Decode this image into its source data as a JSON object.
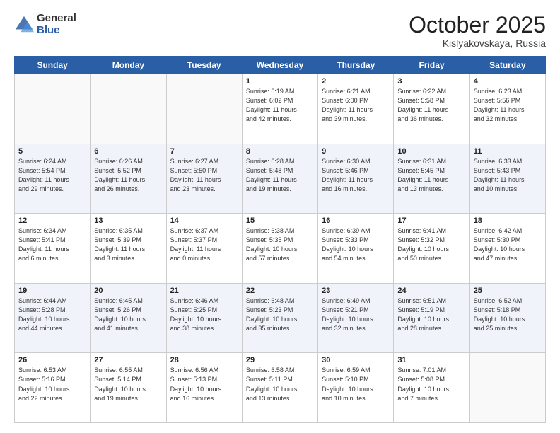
{
  "logo": {
    "general": "General",
    "blue": "Blue"
  },
  "header": {
    "month": "October 2025",
    "location": "Kislyakovskaya, Russia"
  },
  "weekdays": [
    "Sunday",
    "Monday",
    "Tuesday",
    "Wednesday",
    "Thursday",
    "Friday",
    "Saturday"
  ],
  "weeks": [
    [
      {
        "day": "",
        "info": ""
      },
      {
        "day": "",
        "info": ""
      },
      {
        "day": "",
        "info": ""
      },
      {
        "day": "1",
        "info": "Sunrise: 6:19 AM\nSunset: 6:02 PM\nDaylight: 11 hours\nand 42 minutes."
      },
      {
        "day": "2",
        "info": "Sunrise: 6:21 AM\nSunset: 6:00 PM\nDaylight: 11 hours\nand 39 minutes."
      },
      {
        "day": "3",
        "info": "Sunrise: 6:22 AM\nSunset: 5:58 PM\nDaylight: 11 hours\nand 36 minutes."
      },
      {
        "day": "4",
        "info": "Sunrise: 6:23 AM\nSunset: 5:56 PM\nDaylight: 11 hours\nand 32 minutes."
      }
    ],
    [
      {
        "day": "5",
        "info": "Sunrise: 6:24 AM\nSunset: 5:54 PM\nDaylight: 11 hours\nand 29 minutes."
      },
      {
        "day": "6",
        "info": "Sunrise: 6:26 AM\nSunset: 5:52 PM\nDaylight: 11 hours\nand 26 minutes."
      },
      {
        "day": "7",
        "info": "Sunrise: 6:27 AM\nSunset: 5:50 PM\nDaylight: 11 hours\nand 23 minutes."
      },
      {
        "day": "8",
        "info": "Sunrise: 6:28 AM\nSunset: 5:48 PM\nDaylight: 11 hours\nand 19 minutes."
      },
      {
        "day": "9",
        "info": "Sunrise: 6:30 AM\nSunset: 5:46 PM\nDaylight: 11 hours\nand 16 minutes."
      },
      {
        "day": "10",
        "info": "Sunrise: 6:31 AM\nSunset: 5:45 PM\nDaylight: 11 hours\nand 13 minutes."
      },
      {
        "day": "11",
        "info": "Sunrise: 6:33 AM\nSunset: 5:43 PM\nDaylight: 11 hours\nand 10 minutes."
      }
    ],
    [
      {
        "day": "12",
        "info": "Sunrise: 6:34 AM\nSunset: 5:41 PM\nDaylight: 11 hours\nand 6 minutes."
      },
      {
        "day": "13",
        "info": "Sunrise: 6:35 AM\nSunset: 5:39 PM\nDaylight: 11 hours\nand 3 minutes."
      },
      {
        "day": "14",
        "info": "Sunrise: 6:37 AM\nSunset: 5:37 PM\nDaylight: 11 hours\nand 0 minutes."
      },
      {
        "day": "15",
        "info": "Sunrise: 6:38 AM\nSunset: 5:35 PM\nDaylight: 10 hours\nand 57 minutes."
      },
      {
        "day": "16",
        "info": "Sunrise: 6:39 AM\nSunset: 5:33 PM\nDaylight: 10 hours\nand 54 minutes."
      },
      {
        "day": "17",
        "info": "Sunrise: 6:41 AM\nSunset: 5:32 PM\nDaylight: 10 hours\nand 50 minutes."
      },
      {
        "day": "18",
        "info": "Sunrise: 6:42 AM\nSunset: 5:30 PM\nDaylight: 10 hours\nand 47 minutes."
      }
    ],
    [
      {
        "day": "19",
        "info": "Sunrise: 6:44 AM\nSunset: 5:28 PM\nDaylight: 10 hours\nand 44 minutes."
      },
      {
        "day": "20",
        "info": "Sunrise: 6:45 AM\nSunset: 5:26 PM\nDaylight: 10 hours\nand 41 minutes."
      },
      {
        "day": "21",
        "info": "Sunrise: 6:46 AM\nSunset: 5:25 PM\nDaylight: 10 hours\nand 38 minutes."
      },
      {
        "day": "22",
        "info": "Sunrise: 6:48 AM\nSunset: 5:23 PM\nDaylight: 10 hours\nand 35 minutes."
      },
      {
        "day": "23",
        "info": "Sunrise: 6:49 AM\nSunset: 5:21 PM\nDaylight: 10 hours\nand 32 minutes."
      },
      {
        "day": "24",
        "info": "Sunrise: 6:51 AM\nSunset: 5:19 PM\nDaylight: 10 hours\nand 28 minutes."
      },
      {
        "day": "25",
        "info": "Sunrise: 6:52 AM\nSunset: 5:18 PM\nDaylight: 10 hours\nand 25 minutes."
      }
    ],
    [
      {
        "day": "26",
        "info": "Sunrise: 6:53 AM\nSunset: 5:16 PM\nDaylight: 10 hours\nand 22 minutes."
      },
      {
        "day": "27",
        "info": "Sunrise: 6:55 AM\nSunset: 5:14 PM\nDaylight: 10 hours\nand 19 minutes."
      },
      {
        "day": "28",
        "info": "Sunrise: 6:56 AM\nSunset: 5:13 PM\nDaylight: 10 hours\nand 16 minutes."
      },
      {
        "day": "29",
        "info": "Sunrise: 6:58 AM\nSunset: 5:11 PM\nDaylight: 10 hours\nand 13 minutes."
      },
      {
        "day": "30",
        "info": "Sunrise: 6:59 AM\nSunset: 5:10 PM\nDaylight: 10 hours\nand 10 minutes."
      },
      {
        "day": "31",
        "info": "Sunrise: 7:01 AM\nSunset: 5:08 PM\nDaylight: 10 hours\nand 7 minutes."
      },
      {
        "day": "",
        "info": ""
      }
    ]
  ]
}
